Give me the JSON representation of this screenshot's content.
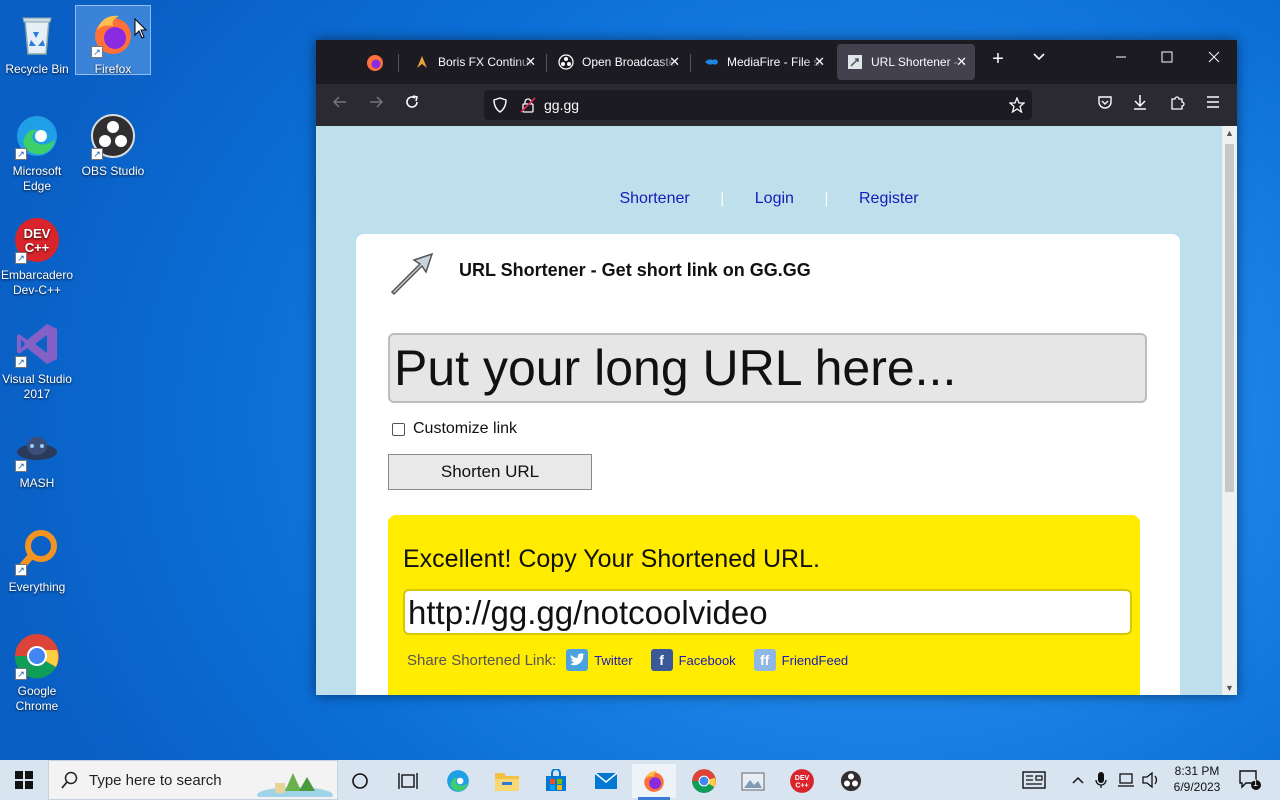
{
  "desktop": {
    "icons": [
      {
        "label": "Recycle Bin"
      },
      {
        "label": "Firefox"
      },
      {
        "label": "Microsoft Edge"
      },
      {
        "label": "OBS Studio"
      },
      {
        "label": "Embarcadero Dev-C++"
      },
      {
        "label": "Visual Studio 2017"
      },
      {
        "label": "MASH"
      },
      {
        "label": "Everything"
      },
      {
        "label": "Google Chrome"
      }
    ]
  },
  "browser": {
    "tabs": [
      {
        "label": "Boris FX Continuum",
        "icon": "boris-fx-icon"
      },
      {
        "label": "Open Broadcaster",
        "icon": "obs-icon"
      },
      {
        "label": "MediaFire - File sharing",
        "icon": "mediafire-icon"
      },
      {
        "label": "URL Shortener - Get",
        "icon": "gg-icon",
        "active": true
      }
    ],
    "new_tab_symbol": "+",
    "url": "gg.gg"
  },
  "page": {
    "nav": {
      "shortener": "Shortener",
      "login": "Login",
      "register": "Register",
      "separator": "|"
    },
    "title": "URL Shortener - Get short link on GG.GG",
    "long_url_placeholder": "Put your long URL here...",
    "customize_label": "Customize link",
    "shorten_button": "Shorten URL",
    "result": {
      "heading": "Excellent! Copy Your Shortened URL.",
      "short_url": "http://gg.gg/notcoolvideo",
      "share_label": "Share Shortened Link:",
      "share_links": [
        "Twitter",
        "Facebook",
        "FriendFeed"
      ]
    }
  },
  "taskbar": {
    "search_placeholder": "Type here to search",
    "time": "8:31 PM",
    "date": "6/9/2023",
    "notification_count": "1"
  },
  "colors": {
    "result_bg": "#ffec00",
    "page_bg": "#bde0ec",
    "link": "#1a1ab8"
  }
}
